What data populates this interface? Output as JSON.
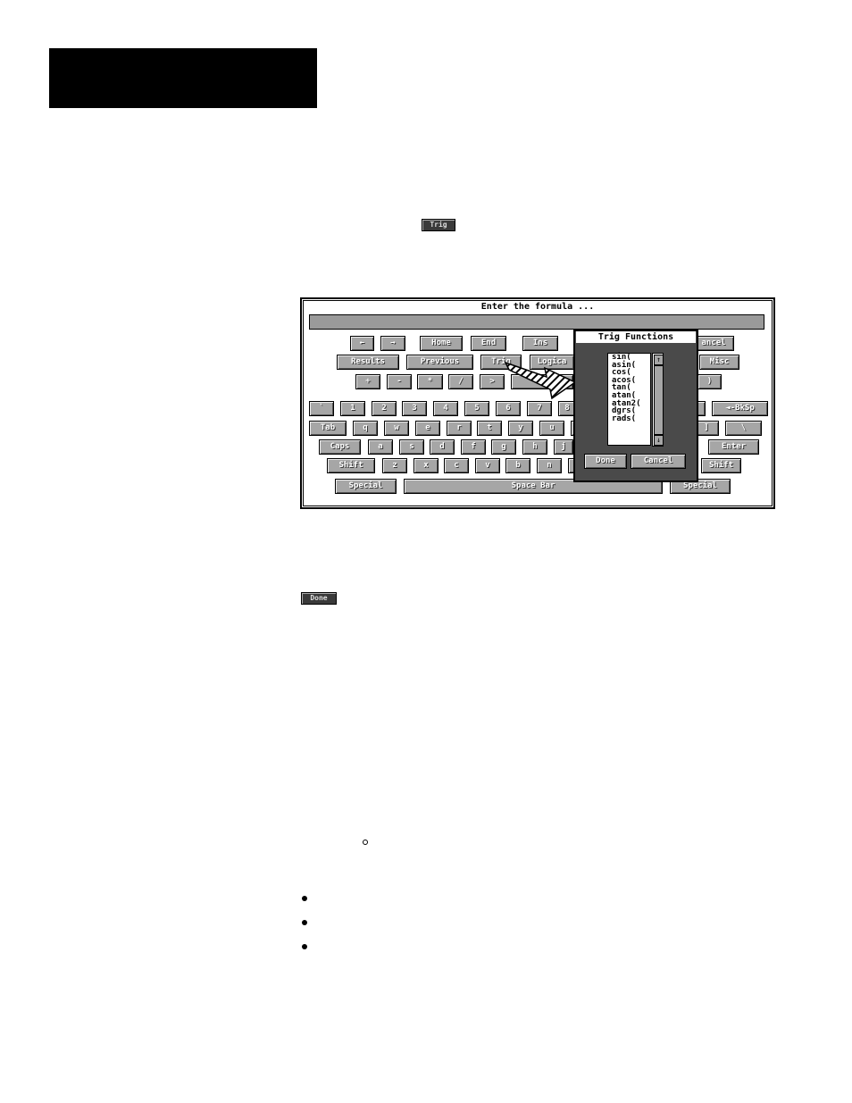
{
  "inline_buttons": {
    "trig": "Trig",
    "done": "Done"
  },
  "dialog": {
    "title": "Enter the formula ...",
    "formula_value": "",
    "keys": [
      [
        "←",
        "→",
        "Home",
        "End",
        "Ins",
        "ancel"
      ],
      [
        "Results",
        "Previous",
        "Trig",
        "Logica",
        "Misc"
      ],
      [
        "+",
        "-",
        "*",
        "/",
        ">",
        "",
        ")"
      ],
      [
        "`",
        "1",
        "2",
        "3",
        "4",
        "5",
        "6",
        "7",
        "8",
        "",
        "◄-BkSp"
      ],
      [
        "Tab",
        "q",
        "w",
        "e",
        "r",
        "t",
        "y",
        "u",
        "",
        "]",
        "\\"
      ],
      [
        "Caps",
        "a",
        "s",
        "d",
        "f",
        "g",
        "h",
        "j",
        "Enter"
      ],
      [
        "Shift",
        "z",
        "x",
        "c",
        "v",
        "b",
        "n",
        "",
        "Shift"
      ],
      [
        "Special",
        "Space Bar",
        "Special"
      ]
    ]
  },
  "trig_popup": {
    "title": "Trig Functions",
    "items": [
      "sin(",
      "asin(",
      "cos(",
      "acos(",
      "tan(",
      "atan(",
      "atan2(",
      "dgrs(",
      "rads("
    ],
    "done": "Done",
    "cancel": "Cancel",
    "scroll_up": "↑",
    "scroll_down": "↓"
  },
  "colors": {
    "key": "#a6a6a6",
    "popup": "#4a4a4a",
    "header": "#000000"
  }
}
